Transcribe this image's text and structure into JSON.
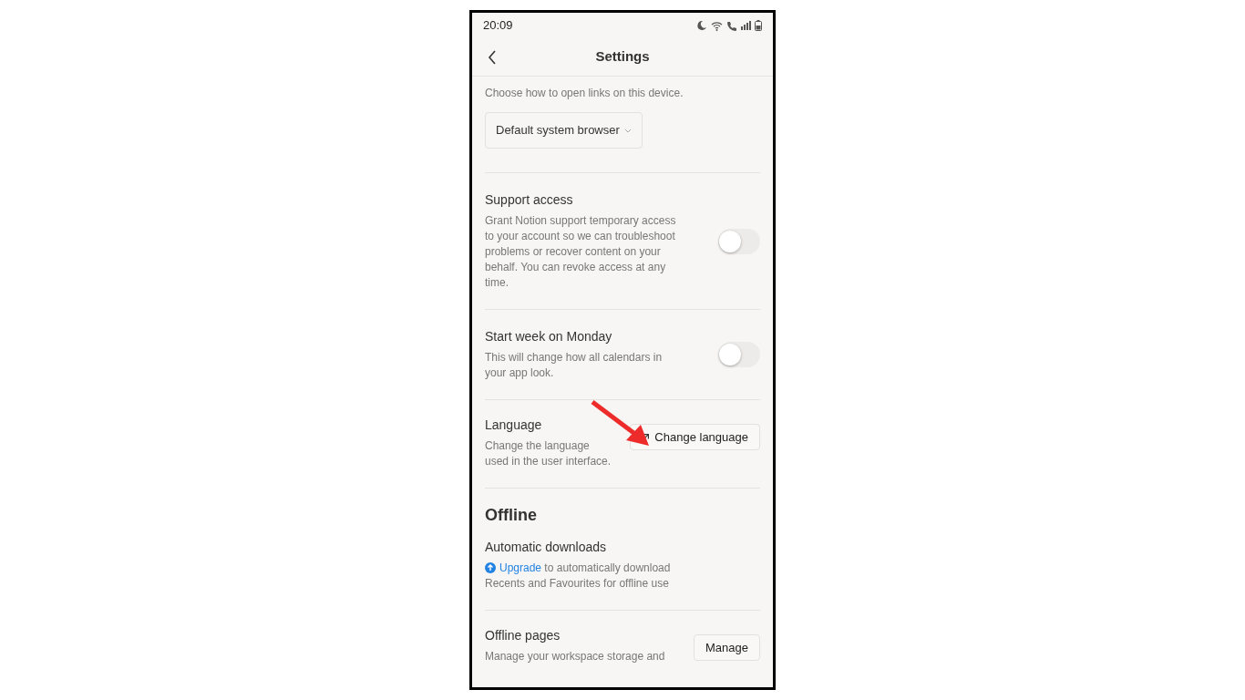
{
  "status_bar": {
    "time": "20:09"
  },
  "header": {
    "title": "Settings"
  },
  "items": [
    {
      "kind": "dropdown",
      "description": "Choose how to open links on this device.",
      "value": "Default system browser"
    },
    {
      "kind": "toggle",
      "title": "Support access",
      "description": "Grant Notion support temporary access to your account so we can troubleshoot problems or recover content on your behalf. You can revoke access at any time.",
      "on": false
    },
    {
      "kind": "toggle",
      "title": "Start week on Monday",
      "description": "This will change how all calendars in your app look.",
      "on": false
    },
    {
      "kind": "button",
      "title": "Language",
      "description": "Change the language used in the user interface.",
      "button": "Change language"
    },
    {
      "kind": "heading",
      "title": "Offline"
    },
    {
      "kind": "upgrade",
      "title": "Automatic downloads",
      "link": "Upgrade",
      "description": "to automatically download Recents and Favourites for offline use"
    },
    {
      "kind": "manage",
      "title": "Offline pages",
      "description": "Manage your workspace storage and",
      "button": "Manage"
    }
  ]
}
